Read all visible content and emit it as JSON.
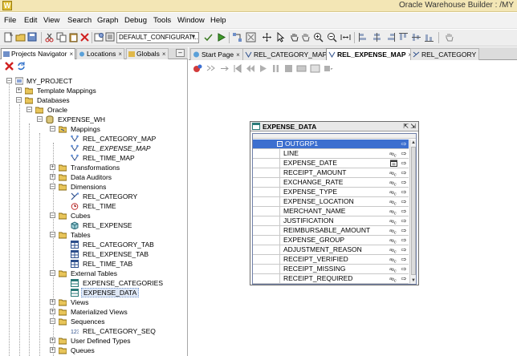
{
  "window": {
    "title": "Oracle Warehouse Builder : /MY",
    "app_icon_letter": "W"
  },
  "menubar": [
    "File",
    "Edit",
    "View",
    "Search",
    "Graph",
    "Debug",
    "Tools",
    "Window",
    "Help"
  ],
  "toolbar": {
    "configuration": "DEFAULT_CONFIGURATI..."
  },
  "left_panel": {
    "tabs": [
      {
        "label": "Projects Navigator",
        "closable": true,
        "active": true
      },
      {
        "label": "Locations",
        "closable": true,
        "active": false
      },
      {
        "label": "Globals",
        "closable": true,
        "active": false
      }
    ],
    "minimize_label": "–",
    "tree": {
      "project": "MY_PROJECT",
      "template_mappings": "Template Mappings",
      "databases": "Databases",
      "oracle": "Oracle",
      "module": "EXPENSE_WH",
      "mappings": "Mappings",
      "mapping_items": [
        "REL_CATEGORY_MAP",
        "REL_EXPENSE_MAP",
        "REL_TIME_MAP"
      ],
      "transformations": "Transformations",
      "data_auditors": "Data Auditors",
      "dimensions": "Dimensions",
      "dimension_items": [
        "REL_CATEGORY",
        "REL_TIME"
      ],
      "cubes": "Cubes",
      "cube_items": [
        "REL_EXPENSE"
      ],
      "tables": "Tables",
      "table_items": [
        "REL_CATEGORY_TAB",
        "REL_EXPENSE_TAB",
        "REL_TIME_TAB"
      ],
      "external_tables": "External Tables",
      "external_items": [
        "EXPENSE_CATEGORIES",
        "EXPENSE_DATA"
      ],
      "views": "Views",
      "materialized_views": "Materialized Views",
      "sequences": "Sequences",
      "sequence_items": [
        "REL_CATEGORY_SEQ"
      ],
      "user_defined_types": "User Defined Types",
      "queues": "Queues"
    }
  },
  "editor": {
    "tabs": [
      {
        "label": "Start Page",
        "active": false
      },
      {
        "label": "REL_CATEGORY_MAP",
        "active": false
      },
      {
        "label": "REL_EXPENSE_MAP",
        "active": true
      },
      {
        "label": "REL_CATEGORY",
        "active": false
      }
    ],
    "operator": {
      "title": "EXPENSE_DATA",
      "group": "OUTGRP1",
      "attributes": [
        {
          "name": "LINE",
          "type": "abc"
        },
        {
          "name": "EXPENSE_DATE",
          "type": "date"
        },
        {
          "name": "RECEIPT_AMOUNT",
          "type": "abc"
        },
        {
          "name": "EXCHANGE_RATE",
          "type": "abc"
        },
        {
          "name": "EXPENSE_TYPE",
          "type": "abc"
        },
        {
          "name": "EXPENSE_LOCATION",
          "type": "abc"
        },
        {
          "name": "MERCHANT_NAME",
          "type": "abc"
        },
        {
          "name": "JUSTIFICATION",
          "type": "abc"
        },
        {
          "name": "REIMBURSABLE_AMOUNT",
          "type": "abc"
        },
        {
          "name": "EXPENSE_GROUP",
          "type": "abc"
        },
        {
          "name": "ADJUSTMENT_REASON",
          "type": "abc"
        },
        {
          "name": "RECEIPT_VERIFIED",
          "type": "abc"
        },
        {
          "name": "RECEIPT_MISSING",
          "type": "abc"
        },
        {
          "name": "RECEIPT_REQUIRED",
          "type": "abc"
        }
      ]
    }
  },
  "colors": {
    "titlebar": "#f3e6b5",
    "selection": "#3c6fcf",
    "menubar": "#f2f2f2"
  }
}
